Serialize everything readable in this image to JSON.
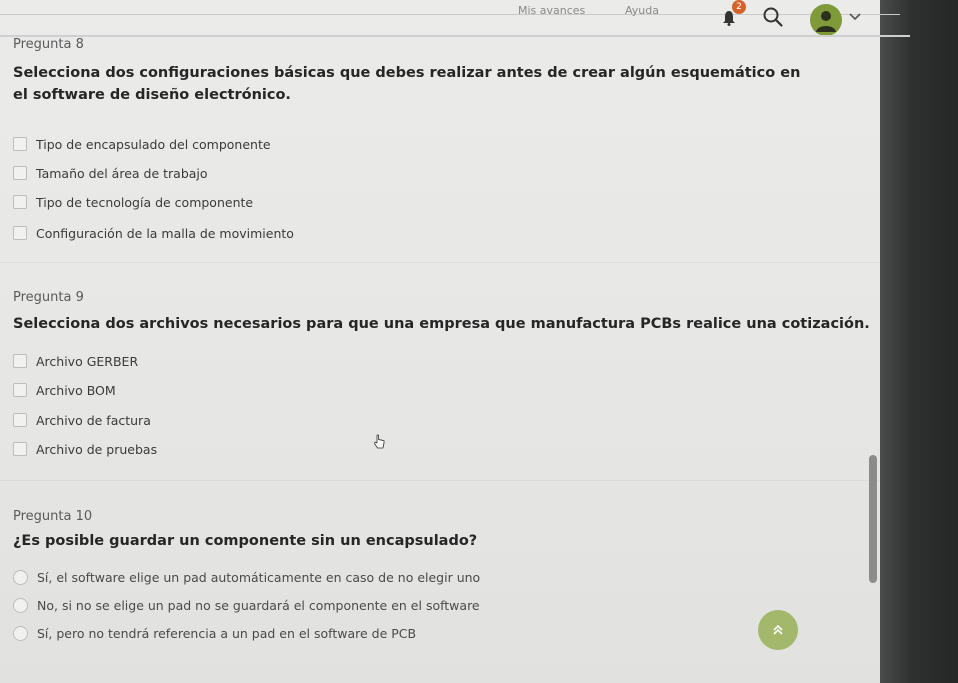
{
  "header": {
    "nav": [
      "Mis avances",
      "Ayuda"
    ],
    "notification_count": "2",
    "accent_color": "#7f9a38",
    "icons": [
      "bell-icon",
      "search-icon",
      "avatar-icon",
      "chevron-down-icon"
    ]
  },
  "questions": [
    {
      "number": "Pregunta 8",
      "text": "Selecciona dos configuraciones básicas que debes realizar antes de crear algún esquemático en el software de diseño electrónico.",
      "input_type": "checkbox",
      "options": [
        "Tipo de encapsulado del componente",
        "Tamaño del área de trabajo",
        "Tipo de tecnología de componente",
        "Configuración de la malla de movimiento"
      ]
    },
    {
      "number": "Pregunta 9",
      "text": "Selecciona dos archivos necesarios para que una empresa que manufactura PCBs realice una cotización.",
      "input_type": "checkbox",
      "options": [
        "Archivo GERBER",
        "Archivo BOM",
        "Archivo de factura",
        "Archivo de pruebas"
      ]
    },
    {
      "number": "Pregunta 10",
      "text": "¿Es posible guardar un componente sin un encapsulado?",
      "input_type": "radio",
      "options": [
        "Sí, el software elige un pad automáticamente en caso de no elegir uno",
        "No, si no se elige un pad no se guardará el componente en el software",
        "Sí, pero no tendrá referencia a un pad en el software de PCB"
      ]
    }
  ],
  "scroll_top_icon": "double-chevron-up-icon"
}
